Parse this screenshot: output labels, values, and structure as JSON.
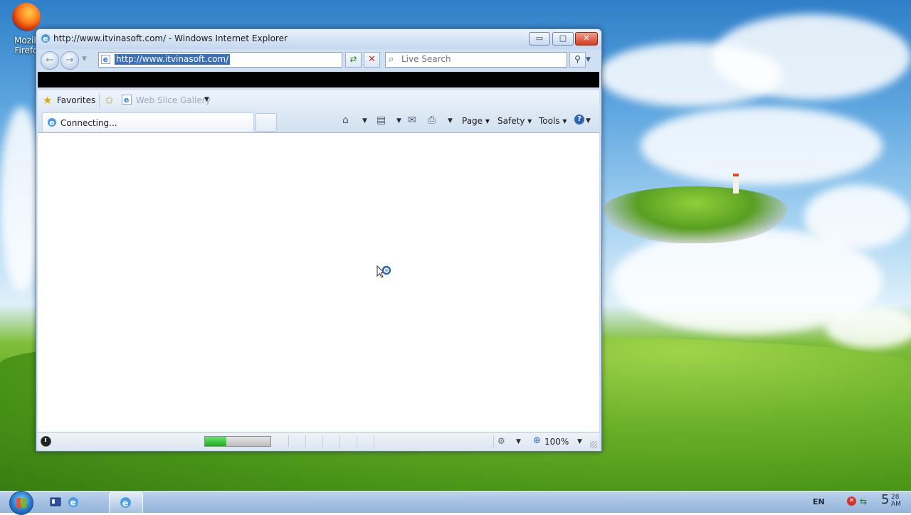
{
  "desktop": {
    "icons": [
      {
        "label_line1": "Mozill",
        "label_line2": "Firefo",
        "icon": "firefox-icon"
      }
    ]
  },
  "window": {
    "title": "http://www.itvinasoft.com/ - Windows Internet Explorer",
    "controls": {
      "minimize": "▭",
      "maximize": "□",
      "close": "✕"
    }
  },
  "navbar": {
    "back_icon": "back-arrow-icon",
    "forward_icon": "forward-arrow-icon",
    "address_value": "http://www.itvinasoft.com/",
    "search_placeholder": "Live Search"
  },
  "favorites_bar": {
    "favorites_label": "Favorites",
    "web_slice_label": "Web Slice Gallery"
  },
  "tabs": [
    {
      "label": "Connecting...",
      "active": true
    }
  ],
  "command_bar": {
    "page_label": "Page",
    "safety_label": "Safety",
    "tools_label": "Tools"
  },
  "status_bar": {
    "progress": 0.33,
    "zoom": "100%"
  },
  "taskbar": {
    "language": "EN",
    "clock_hour": "5",
    "clock_minute": "28",
    "clock_ampm": "AM"
  },
  "colors": {
    "accent": "#3b6fb8",
    "close_button": "#d2391c",
    "progress_fill": "#1cae1c"
  }
}
